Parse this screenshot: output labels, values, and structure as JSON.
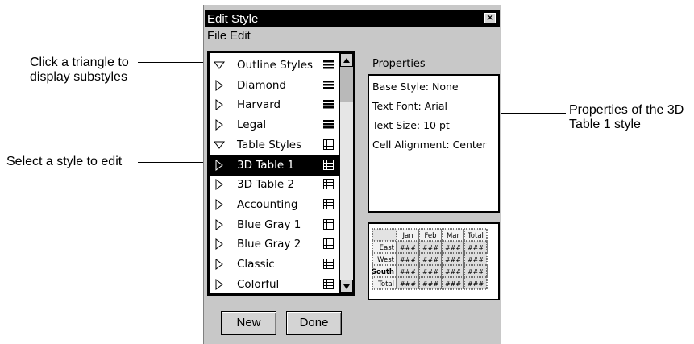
{
  "callouts": {
    "triangle_line1": "Click a triangle to",
    "triangle_line2": "display substyles",
    "select": "Select a style to edit",
    "properties_line1": "Properties of the 3D",
    "properties_line2": "Table 1 style"
  },
  "window": {
    "title": "Edit Style",
    "menu": [
      "File",
      "Edit"
    ]
  },
  "style_list": [
    {
      "label": "Outline Styles",
      "expanded": true,
      "kind": "outline",
      "selected": false
    },
    {
      "label": "Diamond",
      "expanded": false,
      "kind": "outline",
      "selected": false
    },
    {
      "label": "Harvard",
      "expanded": false,
      "kind": "outline",
      "selected": false
    },
    {
      "label": "Legal",
      "expanded": false,
      "kind": "outline",
      "selected": false
    },
    {
      "label": "Table Styles",
      "expanded": true,
      "kind": "table",
      "selected": false
    },
    {
      "label": "3D Table 1",
      "expanded": false,
      "kind": "table",
      "selected": true
    },
    {
      "label": "3D Table 2",
      "expanded": false,
      "kind": "table",
      "selected": false
    },
    {
      "label": "Accounting",
      "expanded": false,
      "kind": "table",
      "selected": false
    },
    {
      "label": "Blue Gray 1",
      "expanded": false,
      "kind": "table",
      "selected": false
    },
    {
      "label": "Blue Gray 2",
      "expanded": false,
      "kind": "table",
      "selected": false
    },
    {
      "label": "Classic",
      "expanded": false,
      "kind": "table",
      "selected": false
    },
    {
      "label": "Colorful",
      "expanded": false,
      "kind": "table",
      "selected": false
    }
  ],
  "properties": {
    "label": "Properties",
    "items": [
      "Base Style: None",
      "Text Font: Arial",
      "Text Size: 10 pt",
      "Cell Alignment: Center"
    ]
  },
  "preview": {
    "columns": [
      "Jan",
      "Feb",
      "Mar",
      "Total"
    ],
    "rows": [
      "East",
      "West",
      "South",
      "Total"
    ],
    "cell": "###"
  },
  "buttons": {
    "new": "New",
    "done": "Done"
  },
  "icons": {
    "outline": "outline-list-icon",
    "table": "table-grid-icon",
    "expanded": "triangle-down-icon",
    "collapsed": "triangle-right-icon"
  }
}
